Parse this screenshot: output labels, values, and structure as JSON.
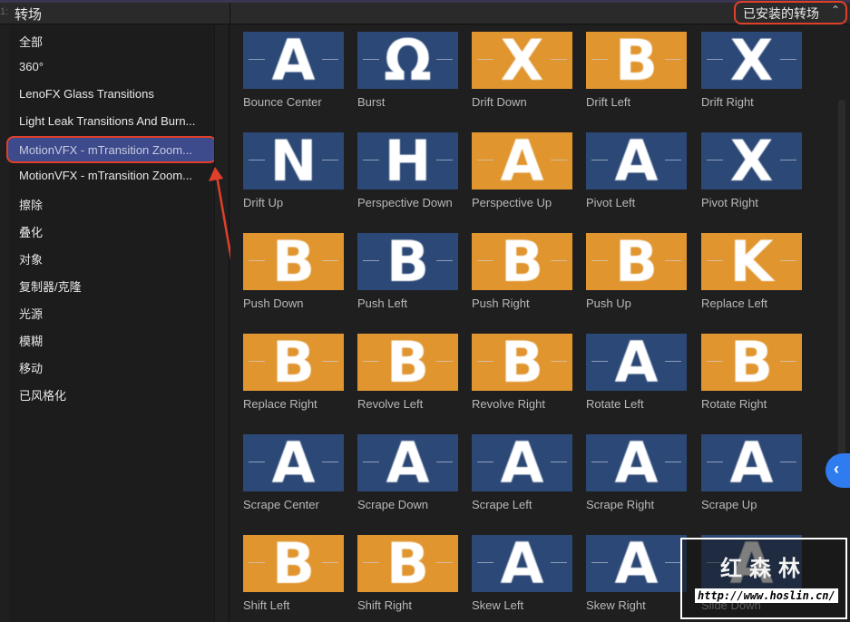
{
  "header": {
    "index": "1:",
    "title": "转场",
    "filter_label": "已安装的转场",
    "filter_icon": "up-down-chevron-icon"
  },
  "sidebar": {
    "items": [
      {
        "label": "全部"
      },
      {
        "label": "360°"
      },
      {
        "label": "LenoFX Glass Transitions"
      },
      {
        "label": "Light Leak Transitions And Burn..."
      },
      {
        "label": "MotionVFX - mTransition Zoom...",
        "selected": true
      },
      {
        "label": "MotionVFX - mTransition Zoom..."
      },
      {
        "label": "擦除"
      },
      {
        "label": "叠化"
      },
      {
        "label": "对象"
      },
      {
        "label": "复制器/克隆"
      },
      {
        "label": "光源"
      },
      {
        "label": "模糊"
      },
      {
        "label": "移动"
      },
      {
        "label": "已风格化"
      }
    ]
  },
  "colors": {
    "blue": "#2c4876",
    "orange": "#e0952f",
    "selection": "#3d4a8c",
    "highlight": "#e0402a",
    "accent": "#2f7bf0"
  },
  "transitions": [
    {
      "name": "Bounce Center",
      "bg": "blue",
      "glyph": "A"
    },
    {
      "name": "Burst",
      "bg": "blue",
      "glyph": "Ω"
    },
    {
      "name": "Drift Down",
      "bg": "orange",
      "glyph": "X"
    },
    {
      "name": "Drift Left",
      "bg": "orange",
      "glyph": "B"
    },
    {
      "name": "Drift Right",
      "bg": "blue",
      "glyph": "X"
    },
    {
      "name": "Drift Up",
      "bg": "blue",
      "glyph": "N"
    },
    {
      "name": "Perspective Down",
      "bg": "blue",
      "glyph": "H"
    },
    {
      "name": "Perspective Up",
      "bg": "orange",
      "glyph": "A"
    },
    {
      "name": "Pivot Left",
      "bg": "blue",
      "glyph": "A"
    },
    {
      "name": "Pivot Right",
      "bg": "blue",
      "glyph": "X"
    },
    {
      "name": "Push Down",
      "bg": "orange",
      "glyph": "B"
    },
    {
      "name": "Push Left",
      "bg": "blue",
      "glyph": "B"
    },
    {
      "name": "Push Right",
      "bg": "orange",
      "glyph": "B"
    },
    {
      "name": "Push Up",
      "bg": "orange",
      "glyph": "B"
    },
    {
      "name": "Replace Left",
      "bg": "orange",
      "glyph": "K"
    },
    {
      "name": "Replace Right",
      "bg": "orange",
      "glyph": "B"
    },
    {
      "name": "Revolve Left",
      "bg": "orange",
      "glyph": "B"
    },
    {
      "name": "Revolve Right",
      "bg": "orange",
      "glyph": "B"
    },
    {
      "name": "Rotate Left",
      "bg": "blue",
      "glyph": "A"
    },
    {
      "name": "Rotate Right",
      "bg": "orange",
      "glyph": "B"
    },
    {
      "name": "Scrape Center",
      "bg": "blue",
      "glyph": "A"
    },
    {
      "name": "Scrape Down",
      "bg": "blue",
      "glyph": "A"
    },
    {
      "name": "Scrape Left",
      "bg": "blue",
      "glyph": "A"
    },
    {
      "name": "Scrape Right",
      "bg": "blue",
      "glyph": "A"
    },
    {
      "name": "Scrape Up",
      "bg": "blue",
      "glyph": "A"
    },
    {
      "name": "Shift Left",
      "bg": "orange",
      "glyph": "B"
    },
    {
      "name": "Shift Right",
      "bg": "orange",
      "glyph": "B"
    },
    {
      "name": "Skew Left",
      "bg": "blue",
      "glyph": "A"
    },
    {
      "name": "Skew Right",
      "bg": "blue",
      "glyph": "A"
    },
    {
      "name": "Slide Down",
      "bg": "blue",
      "glyph": "A"
    }
  ],
  "side_tab_icon": "chevron-left-icon",
  "watermark": {
    "name": "红森林",
    "url": "http://www.hoslin.cn/"
  }
}
